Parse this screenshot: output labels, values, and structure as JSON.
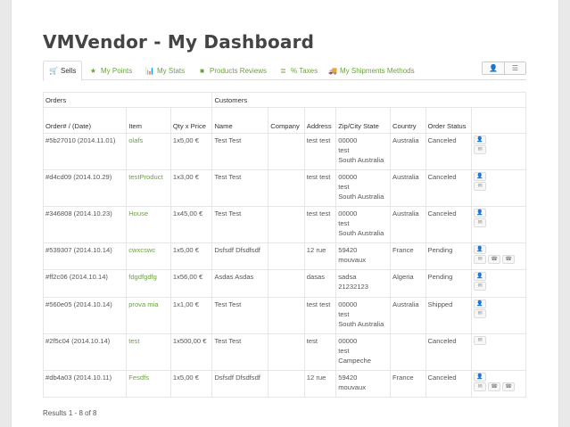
{
  "title": "VMVendor - My Dashboard",
  "tabs": [
    {
      "label": "Sells",
      "icon": "cart-icon",
      "glyph": "🛒"
    },
    {
      "label": "My Points",
      "icon": "star-icon",
      "glyph": "★"
    },
    {
      "label": "My Stats",
      "icon": "bar-chart-icon",
      "glyph": "📊"
    },
    {
      "label": "Products Reviews",
      "icon": "comment-icon",
      "glyph": "■"
    },
    {
      "label": "% Taxes",
      "icon": "list-icon",
      "glyph": "≣"
    },
    {
      "label": "My Shipments Methods",
      "icon": "truck-icon",
      "glyph": "🚚"
    }
  ],
  "toolbar": {
    "user_glyph": "👤",
    "list_glyph": "☰"
  },
  "table": {
    "group_orders": "Orders",
    "group_customers": "Customers",
    "headers": {
      "order": "Order# / (Date)",
      "item": "Item",
      "qty": "Qty x Price",
      "name": "Name",
      "company": "Company",
      "address": "Address",
      "zip": "Zip/City State",
      "country": "Country",
      "status": "Order Status"
    },
    "rows": [
      {
        "order": "#5b27010 (2014.11.01)",
        "item": "olafs",
        "qty": "1x5,00 €",
        "name": "Test Test",
        "company": "",
        "address": "test test",
        "zip": "00000",
        "city": "test",
        "state": "South Australia",
        "country": "Australia",
        "status": "Canceled",
        "actions": [
          "user",
          "mail"
        ]
      },
      {
        "order": "#d4cd09 (2014.10.29)",
        "item": "testProduct",
        "qty": "1x3,00 €",
        "name": "Test Test",
        "company": "",
        "address": "test test",
        "zip": "00000",
        "city": "test",
        "state": "South Australia",
        "country": "Australia",
        "status": "Canceled",
        "actions": [
          "user",
          "mail"
        ]
      },
      {
        "order": "#346808 (2014.10.23)",
        "item": "House",
        "qty": "1x45,00 €",
        "name": "Test Test",
        "company": "",
        "address": "test test",
        "zip": "00000",
        "city": "test",
        "state": "South Australia",
        "country": "Australia",
        "status": "Canceled",
        "actions": [
          "user",
          "mail"
        ]
      },
      {
        "order": "#539307 (2014.10.14)",
        "item": "cwxcswc",
        "qty": "1x5,00 €",
        "name": "Dsfsdf Dfsdfsdf",
        "company": "",
        "address": "12 rue",
        "zip": "59420",
        "city": "mouvaux",
        "state": "",
        "country": "France",
        "status": "Pending",
        "actions": [
          "user",
          "mail",
          "phone",
          "phone"
        ]
      },
      {
        "order": "#ff2c06 (2014.10.14)",
        "item": "fdgdfgdfg",
        "qty": "1x56,00 €",
        "name": "Asdas Asdas",
        "company": "",
        "address": "dasas",
        "zip": "sadsa",
        "city": "21232123",
        "state": "",
        "country": "Algeria",
        "status": "Pending",
        "actions": [
          "user",
          "mail"
        ]
      },
      {
        "order": "#560e05 (2014.10.14)",
        "item": "prova mia",
        "qty": "1x1,00 €",
        "name": "Test Test",
        "company": "",
        "address": "test test",
        "zip": "00000",
        "city": "test",
        "state": "South Australia",
        "country": "Australia",
        "status": "Shipped",
        "actions": [
          "user",
          "mail"
        ]
      },
      {
        "order": "#2f5c04 (2014.10.14)",
        "item": "test",
        "qty": "1x500,00 €",
        "name": "Test Test",
        "company": "",
        "address": "test",
        "zip": "00000",
        "city": "test",
        "state": "Campeche",
        "country": "",
        "status": "Canceled",
        "actions": [
          "mail"
        ]
      },
      {
        "order": "#db4a03 (2014.10.11)",
        "item": "Fesdfs",
        "qty": "1x5,00 €",
        "name": "Dsfsdf Dfsdfsdf",
        "company": "",
        "address": "12 rue",
        "zip": "59420",
        "city": "mouvaux",
        "state": "",
        "country": "France",
        "status": "Canceled",
        "actions": [
          "user",
          "mail",
          "phone",
          "phone"
        ]
      }
    ]
  },
  "results": "Results 1 - 8 of 8",
  "colors": {
    "link": "#6aa33a",
    "title": "#444444",
    "border": "#e6e6e6"
  }
}
